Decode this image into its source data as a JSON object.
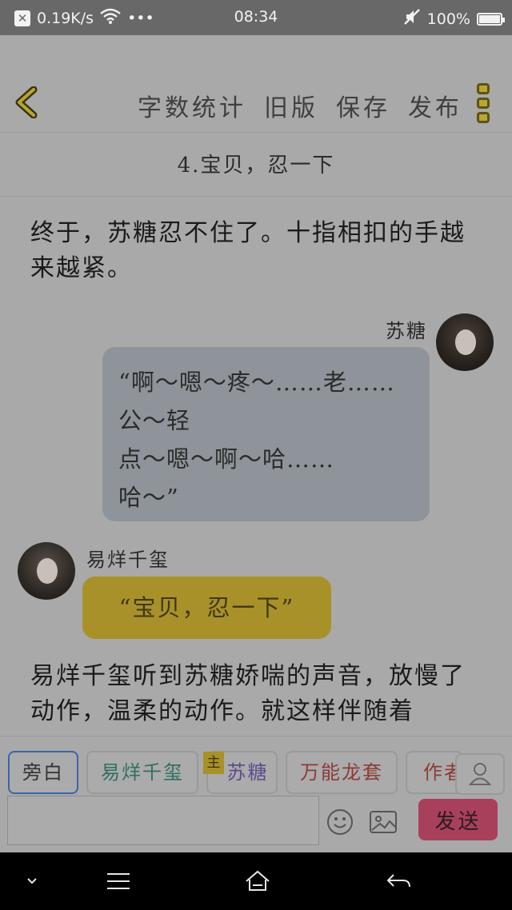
{
  "status_bar": {
    "speed": "0.19K/s",
    "dots": "•••",
    "time": "08:34",
    "battery": "100%",
    "icons": [
      "close-box-icon",
      "wifi-icon",
      "mute-icon",
      "battery-icon"
    ]
  },
  "header": {
    "actions": [
      "字数统计",
      "旧版",
      "保存",
      "发布"
    ],
    "back_icon": "chevron-left-icon",
    "more_icon": "more-vertical-icon"
  },
  "chapter_title": "4.宝贝，忍一下",
  "content": {
    "narration_1": "终于，苏糖忍不住了。十指相扣的手越来越紧。",
    "message_right": {
      "speaker": "苏糖",
      "text": "“啊～嗯～疼～……老……公～轻\n点～嗯～啊～哈……\n哈～”"
    },
    "message_left": {
      "speaker": "易烊千玺",
      "text": "“宝贝，忍一下”"
    },
    "narration_2": "易烊千玺听到苏糖娇喘的声音，放慢了动作，温柔的动作。就这样伴随着"
  },
  "roles": {
    "narrator": "旁白",
    "yi": "易烊千玺",
    "su": "苏糖",
    "su_badge": "主",
    "dragon": "万能龙套",
    "author": "作者"
  },
  "composer": {
    "placeholder": "",
    "send_label": "发送"
  },
  "colors": {
    "status_bar": "#686868",
    "page_bg": "#a9a9a9",
    "bubble_right": "#8e949a",
    "bubble_left": "#a89128",
    "send_button": "#a8405c",
    "accent_gold": "#b9a532"
  }
}
